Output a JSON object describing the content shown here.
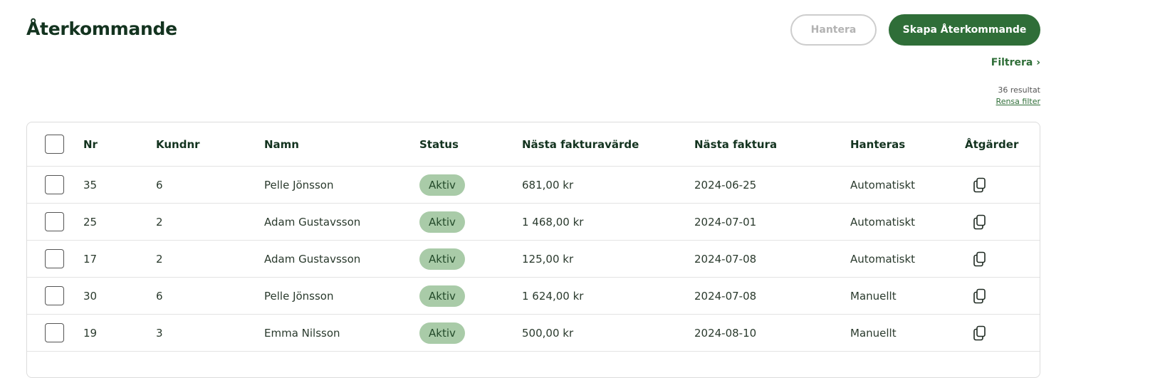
{
  "page": {
    "title": "Återkommande",
    "manage_button": "Hantera",
    "create_button": "Skapa Återkommande",
    "filter_link": "Filtrera ›",
    "result_count": "36 resultat",
    "clear_filter": "Rensa filter"
  },
  "colors": {
    "accent": "#2f6e38",
    "badge_bg": "#a9cba8",
    "title": "#13331f"
  },
  "table": {
    "headers": {
      "nr": "Nr",
      "customer_nr": "Kundnr",
      "name": "Namn",
      "status": "Status",
      "next_invoice_value": "Nästa fakturavärde",
      "next_invoice": "Nästa faktura",
      "handled": "Hanteras",
      "actions": "Åtgärder"
    },
    "rows": [
      {
        "nr": "35",
        "customer_nr": "6",
        "name": "Pelle Jönsson",
        "status": "Aktiv",
        "value": "681,00 kr",
        "date": "2024-06-25",
        "handled": "Automatiskt",
        "action_icon": "copy-icon"
      },
      {
        "nr": "25",
        "customer_nr": "2",
        "name": "Adam Gustavsson",
        "status": "Aktiv",
        "value": "1 468,00 kr",
        "date": "2024-07-01",
        "handled": "Automatiskt",
        "action_icon": "copy-icon"
      },
      {
        "nr": "17",
        "customer_nr": "2",
        "name": "Adam Gustavsson",
        "status": "Aktiv",
        "value": "125,00 kr",
        "date": "2024-07-08",
        "handled": "Automatiskt",
        "action_icon": "copy-icon"
      },
      {
        "nr": "30",
        "customer_nr": "6",
        "name": "Pelle Jönsson",
        "status": "Aktiv",
        "value": "1 624,00 kr",
        "date": "2024-07-08",
        "handled": "Manuellt",
        "action_icon": "copy-icon"
      },
      {
        "nr": "19",
        "customer_nr": "3",
        "name": "Emma Nilsson",
        "status": "Aktiv",
        "value": "500,00 kr",
        "date": "2024-08-10",
        "handled": "Manuellt",
        "action_icon": "copy-icon"
      }
    ]
  }
}
